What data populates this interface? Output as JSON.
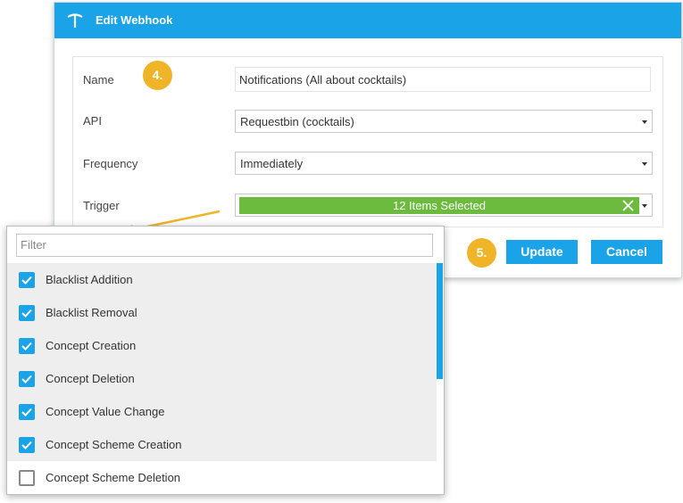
{
  "dialog": {
    "title": "Edit Webhook",
    "accent_color": "#1ba3e8"
  },
  "form": {
    "name_label": "Name",
    "name_value": "Notifications (All about cocktails)",
    "api_label": "API",
    "api_value": "Requestbin (cocktails)",
    "frequency_label": "Frequency",
    "frequency_value": "Immediately",
    "trigger_label": "Trigger",
    "trigger_value": "12 Items Selected",
    "trigger_color": "#6cbb3f"
  },
  "buttons": {
    "update_label": "Update",
    "cancel_label": "Cancel"
  },
  "annotations": {
    "step4": "4.",
    "step5": "5.",
    "color": "#f0b429"
  },
  "dropdown": {
    "filter_placeholder": "Filter",
    "items": [
      {
        "label": "Blacklist Addition",
        "checked": true
      },
      {
        "label": "Blacklist Removal",
        "checked": true
      },
      {
        "label": "Concept Creation",
        "checked": true
      },
      {
        "label": "Concept Deletion",
        "checked": true
      },
      {
        "label": "Concept Value Change",
        "checked": true
      },
      {
        "label": "Concept Scheme Creation",
        "checked": true
      },
      {
        "label": "Concept Scheme Deletion",
        "checked": false
      }
    ]
  },
  "icons": {
    "logo": "pickaxe-icon",
    "clear": "close-icon",
    "checkbox": "check-icon",
    "dropdown": "caret-down-icon"
  }
}
